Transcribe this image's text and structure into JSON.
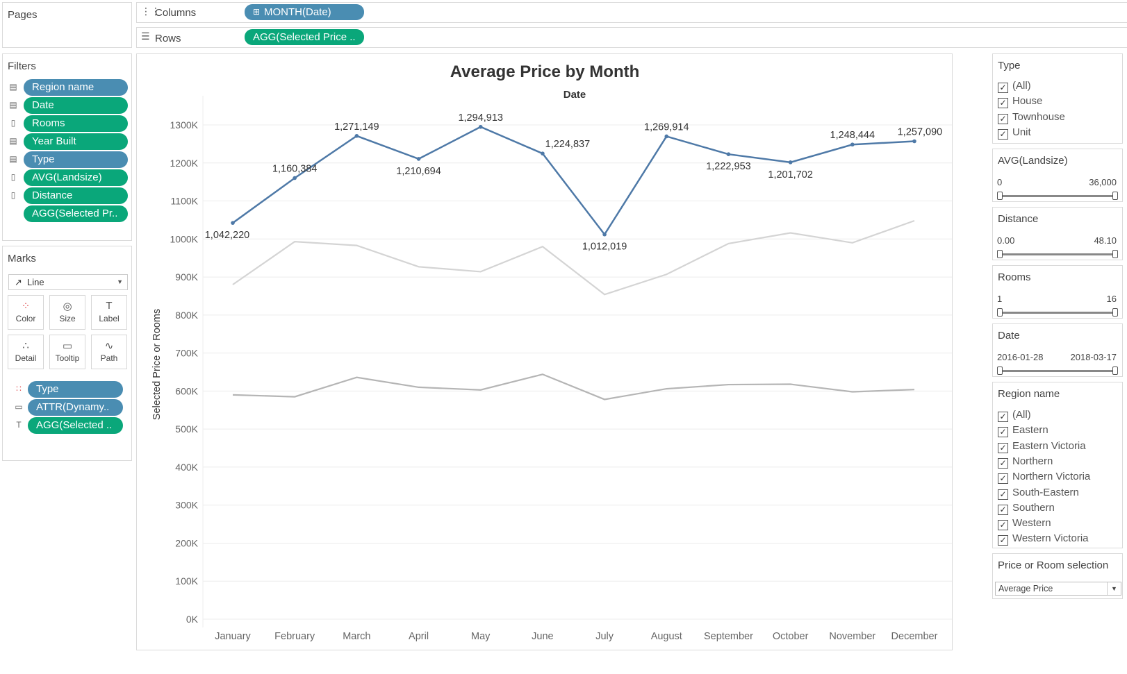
{
  "pages": {
    "title": "Pages"
  },
  "columns_shelf": {
    "label": "Columns",
    "pill": "MONTH(Date)"
  },
  "rows_shelf": {
    "label": "Rows",
    "pill": "AGG(Selected Price .."
  },
  "filters": {
    "title": "Filters",
    "items": [
      {
        "label": "Region name",
        "color": "#4a8db2",
        "icon": "dataset-icon"
      },
      {
        "label": "Date",
        "color": "#0aa77a",
        "icon": "dataset-icon"
      },
      {
        "label": "Rooms",
        "color": "#0aa77a",
        "icon": "cylinder-icon"
      },
      {
        "label": "Year Built",
        "color": "#0aa77a",
        "icon": "dataset-icon"
      },
      {
        "label": "Type",
        "color": "#4a8db2",
        "icon": "dataset-icon"
      },
      {
        "label": "AVG(Landsize)",
        "color": "#0aa77a",
        "icon": "cylinder-icon"
      },
      {
        "label": "Distance",
        "color": "#0aa77a",
        "icon": "cylinder-icon"
      },
      {
        "label": "AGG(Selected Pr..",
        "color": "#0aa77a",
        "icon": ""
      }
    ]
  },
  "marks": {
    "title": "Marks",
    "mark_type": "Line",
    "buttons": [
      {
        "label": "Color",
        "icon": "color-dots-icon"
      },
      {
        "label": "Size",
        "icon": "size-circles-icon"
      },
      {
        "label": "Label",
        "icon": "label-t-icon"
      },
      {
        "label": "Detail",
        "icon": "detail-tree-icon"
      },
      {
        "label": "Tooltip",
        "icon": "tooltip-bubble-icon"
      },
      {
        "label": "Path",
        "icon": "path-line-icon"
      }
    ],
    "fields": [
      {
        "label": "Type",
        "color": "#4a8db2",
        "icon": "color-dots-icon"
      },
      {
        "label": "ATTR(Dynamy..",
        "color": "#4a8db2",
        "icon": "tooltip-bubble-icon"
      },
      {
        "label": "AGG(Selected ..",
        "color": "#0aa77a",
        "icon": "label-t-icon"
      }
    ]
  },
  "type_filter": {
    "title": "Type",
    "options": [
      {
        "label": "(All)",
        "checked": true
      },
      {
        "label": "House",
        "checked": true
      },
      {
        "label": "Townhouse",
        "checked": true
      },
      {
        "label": "Unit",
        "checked": true
      }
    ]
  },
  "landsize_filter": {
    "title": "AVG(Landsize)",
    "min": "0",
    "max": "36,000"
  },
  "distance_filter": {
    "title": "Distance",
    "min": "0.00",
    "max": "48.10"
  },
  "rooms_filter": {
    "title": "Rooms",
    "min": "1",
    "max": "16"
  },
  "date_filter": {
    "title": "Date",
    "min": "2016-01-28",
    "max": "2018-03-17"
  },
  "region_filter": {
    "title": "Region name",
    "options": [
      {
        "label": "(All)",
        "checked": true
      },
      {
        "label": "Eastern",
        "checked": true
      },
      {
        "label": "Eastern Victoria",
        "checked": true
      },
      {
        "label": "Northern",
        "checked": true
      },
      {
        "label": "Northern Victoria",
        "checked": true
      },
      {
        "label": "South-Eastern",
        "checked": true
      },
      {
        "label": "Southern",
        "checked": true
      },
      {
        "label": "Western",
        "checked": true
      },
      {
        "label": "Western Victoria",
        "checked": true
      }
    ]
  },
  "price_selection": {
    "title": "Price or Room selection",
    "value": "Average Price"
  },
  "chart_data": {
    "type": "line",
    "title": "Average Price by Month",
    "xlabel": "Date",
    "ylabel": "Selected Price or Rooms",
    "categories": [
      "January",
      "February",
      "March",
      "April",
      "May",
      "June",
      "July",
      "August",
      "September",
      "October",
      "November",
      "December"
    ],
    "ylim": [
      0,
      1300000
    ],
    "yticks": [
      0,
      100000,
      200000,
      300000,
      400000,
      500000,
      600000,
      700000,
      800000,
      900000,
      1000000,
      1100000,
      1200000,
      1300000
    ],
    "ytick_labels": [
      "0K",
      "100K",
      "200K",
      "300K",
      "400K",
      "500K",
      "600K",
      "700K",
      "800K",
      "900K",
      "1000K",
      "1100K",
      "1200K",
      "1300K"
    ],
    "series": [
      {
        "color": "#4e79a7",
        "values": [
          1042220,
          1160384,
          1271149,
          1210694,
          1294913,
          1224837,
          1012019,
          1269914,
          1222953,
          1201702,
          1248444,
          1257090
        ],
        "labels": [
          "1,042,220",
          "1,160,384",
          "1,271,149",
          "1,210,694",
          "1,294,913",
          "1,224,837",
          "1,012,019",
          "1,269,914",
          "1,222,953",
          "1,201,702",
          "1,248,444",
          "1,257,090"
        ]
      },
      {
        "color": "#d4d4d4",
        "values": [
          880000,
          993000,
          983000,
          927000,
          914000,
          980000,
          854000,
          907000,
          988000,
          1016000,
          990000,
          1048000
        ]
      },
      {
        "color": "#b5b5b5",
        "values": [
          590000,
          585000,
          636000,
          610000,
          603000,
          644000,
          578000,
          606000,
          617000,
          618000,
          598000,
          604000
        ]
      }
    ],
    "grid": true
  }
}
